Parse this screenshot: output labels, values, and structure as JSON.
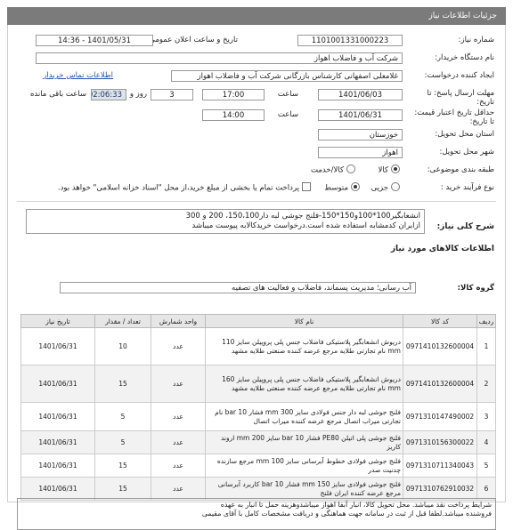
{
  "header": {
    "title": "جزئيات اطلاعات نياز"
  },
  "fields": {
    "need_number_label": "شماره نیاز:",
    "need_number": "1101001331000223",
    "announce_label": "تاریخ و ساعت اعلان عمومی:",
    "announce_value": "1401/05/31 - 14:36",
    "buyer_org_label": "نام دستگاه خریدار:",
    "buyer_org": "شرکت آب و فاضلاب اهواز",
    "requester_label": "ایجاد کننده درخواست:",
    "requester": "غلامعلی اصفهانی کارشناس بازرگانی شرکت آب و فاضلاب اهواز",
    "contact_link": "اطلاعات تماس خریدار",
    "deadline_label": "مهلت ارسال پاسخ: تا تاریخ:",
    "deadline_date": "1401/06/03",
    "time_word": "ساعت",
    "deadline_time": "17:00",
    "days": "3",
    "days_word": "روز و",
    "remaining_time": "02:06:33",
    "remaining_word": "ساعت باقی مانده",
    "validity_label": "حداقل تاریخ اعتبار قیمت: تا تاریخ:",
    "validity_date": "1401/06/31",
    "validity_time": "14:00",
    "province_label": "استان محل تحویل:",
    "province": "خوزستان",
    "city_label": "شهر محل تحویل:",
    "city": "اهواز",
    "category_label": "طبقه بندی موضوعی:",
    "cat_goods": "کالا",
    "cat_goods_service": "کالا/خدمت",
    "process_label": "نوع فرآیند خرید :",
    "proc_partial": "جزیی",
    "proc_medium": "متوسط",
    "payment_note": "پرداخت تمام یا بخشی از مبلغ خرید،از محل \"اسناد خزانه اسلامی\" خواهد بود."
  },
  "description": {
    "label": "شرح کلی نیاز:",
    "line1": "انشعابگیر100*100و150*150-فلنج جوشی لبه دار150،100، 200 و 300",
    "line2": "ازایران کدمشابه استفاده شده است.درخواست خریدکالابه پیوست میباشد"
  },
  "goods_info_title": "اطلاعات کالاهای مورد نیاز",
  "goods_group_label": "گروه کالا:",
  "goods_group": "آب رسانی؛ مدیریت پسماند، فاضلاب و فعالیت های تصفیه",
  "table": {
    "headers": [
      "ردیف",
      "کد کالا",
      "نام کالا",
      "واحد شمارش",
      "تعداد / مقدار",
      "تاریخ نیاز"
    ],
    "rows": [
      {
        "n": "1",
        "code": "0971410132600004",
        "name": "دریوش انشعابگیر پلاستیکی فاضلاب جنس پلی پروپیلن سایز 110 mm نام تجارتی طلایه مرجع عرضه کننده صنعتی طلایه مشهد",
        "unit": "عدد",
        "qty": "10",
        "date": "1401/06/31"
      },
      {
        "n": "2",
        "code": "0971410132600004",
        "name": "دریوش انشعابگیر پلاستیکی فاضلاب جنس پلی پروپیلن سایز 160 mm نام تجارتی طلایه مرجع عرضه کننده صنعتی طلایه مشهد",
        "unit": "عدد",
        "qty": "15",
        "date": "1401/06/31"
      },
      {
        "n": "3",
        "code": "0971310147490002",
        "name": "فلنج جوشی لبه دار جنس فولادی سایز 300 mm فشار 10 bar نام تجارتی میراب اتصال مرجع عرضه کننده میراب اتصال",
        "unit": "عدد",
        "qty": "5",
        "date": "1401/06/31"
      },
      {
        "n": "4",
        "code": "0971310156300022",
        "name": "فلنج جوشی پلی اتیلن PE80 فشار 10 bar سایز 200 mm اروند کاریز",
        "unit": "عدد",
        "qty": "5",
        "date": "1401/06/31"
      },
      {
        "n": "5",
        "code": "0971310711340043",
        "name": "فلنج جوشی فولادی خطوط آبرسانی سایز 100 mm مرجع سازنده چدنیت صدر",
        "unit": "عدد",
        "qty": "15",
        "date": "1401/06/31"
      },
      {
        "n": "6",
        "code": "0971310762910032",
        "name": "فلنج جوشی فولادی سایز 150 mm فشار 10 bar کاربرد آبرسانی مرجع عرضه کننده ایران فلنج",
        "unit": "عدد",
        "qty": "15",
        "date": "1401/06/31"
      }
    ]
  },
  "notes": {
    "line1": "شرایط پرداخت نقد میباشد. محل تحویل کالا، انبار آبفا اهواز میباشدوهزینه حمل تا انبار به عهده",
    "line2": "فروشنده میباشد.لطفا قبل از ثبت در سامانه جهت هماهنگی و دریافت مشخصات کامل با آقای مقیمی"
  }
}
